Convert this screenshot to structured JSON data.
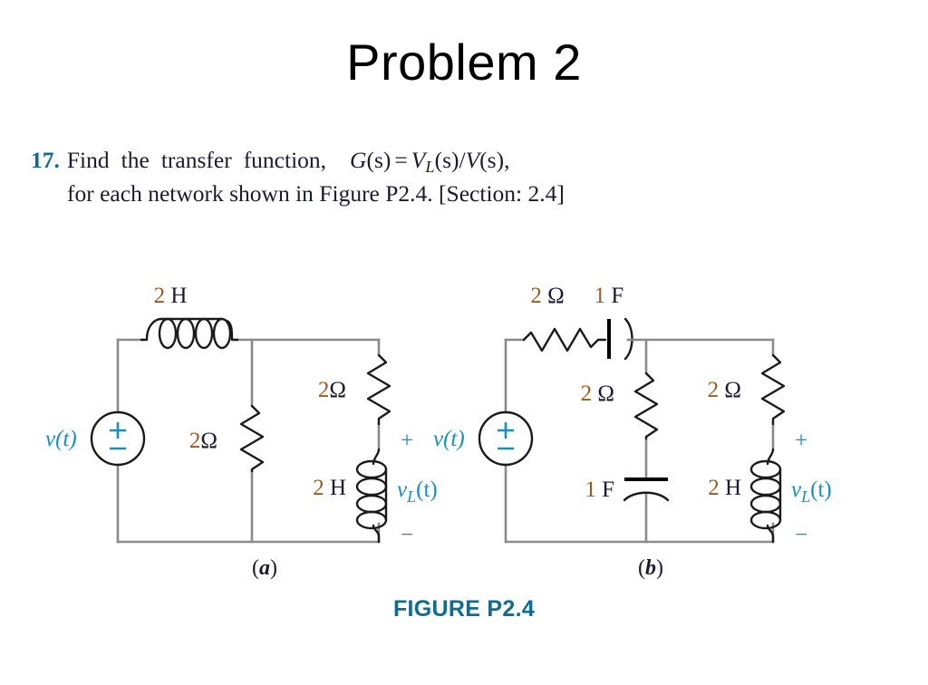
{
  "title": "Problem 2",
  "problem": {
    "number": "17.",
    "words": [
      "Find",
      "the",
      "transfer",
      "function,"
    ],
    "formula_G": "G",
    "formula_s1": "(s)",
    "formula_eq": "=",
    "formula_V": "V",
    "formula_Lsub": "L",
    "formula_s2": "(s)/",
    "formula_V2": "V",
    "formula_s3": "(s),",
    "line2": "for each network shown in Figure P2.4. [Section: 2.4]"
  },
  "figure": {
    "caption": "FIGURE P2.4",
    "subcaption_a": "(a)",
    "subcaption_b": "(b)"
  },
  "circuit_a": {
    "label": "(a)",
    "source_label": "v(t)",
    "source_plus": "+",
    "source_minus": "−",
    "inductor_top": "2 H",
    "resistor_shunt": "2Ω",
    "resistor_right": "2Ω",
    "inductor_right": "2 H",
    "out_plus": "+",
    "out_minus": "−",
    "out_label_v": "v",
    "out_label_sub": "L",
    "out_label_t": "(t)"
  },
  "circuit_b": {
    "label": "(b)",
    "source_label": "v(t)",
    "source_plus": "+",
    "source_minus": "−",
    "resistor_top": "2 Ω",
    "capacitor_top": "1 F",
    "resistor_mid": "2 Ω",
    "capacitor_mid": "1 F",
    "resistor_right": "2 Ω",
    "inductor_right": "2 H",
    "out_plus": "+",
    "out_minus": "−",
    "out_label_v": "v",
    "out_label_sub": "L",
    "out_label_t": "(t)"
  },
  "colors": {
    "accent": "#116a8e",
    "label_blue": "#1590bd",
    "value_brown": "#9a5a20",
    "wire_gray": "#8a8a8a",
    "text_dark": "#1b1b2f"
  }
}
